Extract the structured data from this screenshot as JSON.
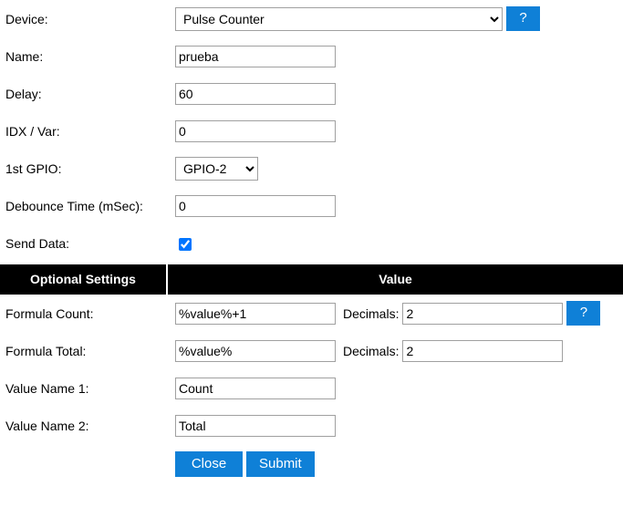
{
  "form": {
    "rows": [
      {
        "label": "Device:",
        "value": "Pulse Counter",
        "control": "select"
      },
      {
        "label": "Name:",
        "value": "prueba",
        "control": "text"
      },
      {
        "label": "Delay:",
        "value": "60",
        "control": "text"
      },
      {
        "label": "IDX / Var:",
        "value": "0",
        "control": "text"
      },
      {
        "label": "1st GPIO:",
        "value": "GPIO-2",
        "control": "select"
      },
      {
        "label": "Debounce Time (mSec):",
        "value": "0",
        "control": "text"
      },
      {
        "label": "Send Data:",
        "value": "checked",
        "control": "checkbox"
      }
    ]
  },
  "section": {
    "col_optional": "Optional Settings",
    "col_value": "Value"
  },
  "optional": {
    "formula_count": {
      "label": "Formula Count:",
      "value": "%value%+1",
      "decimals_label": "Decimals:",
      "decimals_value": "2"
    },
    "formula_total": {
      "label": "Formula Total:",
      "value": "%value%",
      "decimals_label": "Decimals:",
      "decimals_value": "2"
    },
    "value_name_1": {
      "label": "Value Name 1:",
      "value": "Count"
    },
    "value_name_2": {
      "label": "Value Name 2:",
      "value": "Total"
    }
  },
  "buttons": {
    "help": "?",
    "close": "Close",
    "submit": "Submit"
  },
  "colors": {
    "accent_blue": "#0f80d7",
    "header_black": "#000000",
    "border_gray": "#a0a0a0"
  }
}
